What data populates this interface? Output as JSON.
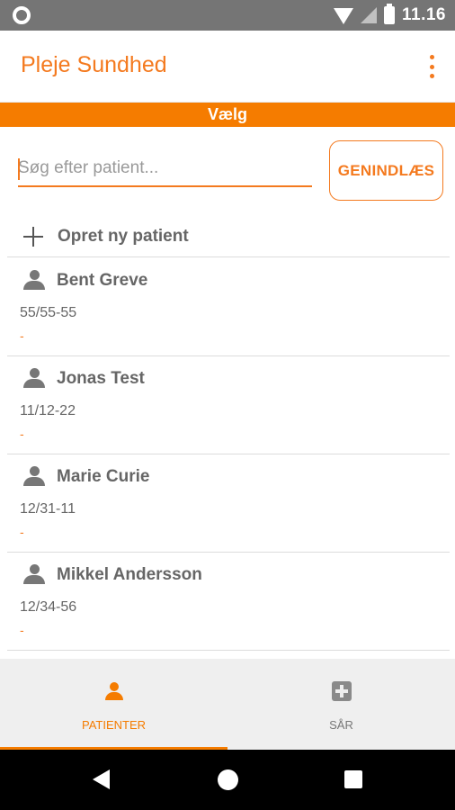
{
  "status_bar": {
    "time": "11.16",
    "icons": [
      "sync-circle-icon",
      "wifi-icon",
      "signal-icon",
      "battery-charging-icon"
    ]
  },
  "app_bar": {
    "title": "Pleje Sundhed",
    "menu_icon": "overflow-menu-icon"
  },
  "section_banner": "Vælg",
  "search": {
    "placeholder": "Søg efter patient...",
    "value": ""
  },
  "reload_button": "GENINDLÆS",
  "create_patient_label": "Opret ny patient",
  "patients": [
    {
      "name": "Bent Greve",
      "id": "55/55-55",
      "extra": "-"
    },
    {
      "name": "Jonas Test",
      "id": "11/12-22",
      "extra": "-"
    },
    {
      "name": "Marie Curie",
      "id": "12/31-11",
      "extra": "-"
    },
    {
      "name": "Mikkel Andersson",
      "id": "12/34-56",
      "extra": "-"
    }
  ],
  "bottom_nav": {
    "tabs": [
      {
        "label": "PATIENTER",
        "icon": "person-icon",
        "active": true
      },
      {
        "label": "SÅR",
        "icon": "medical-cross-icon",
        "active": false
      }
    ]
  },
  "colors": {
    "accent": "#f47a1f",
    "banner": "#f57c00",
    "status_bar": "#757575"
  }
}
